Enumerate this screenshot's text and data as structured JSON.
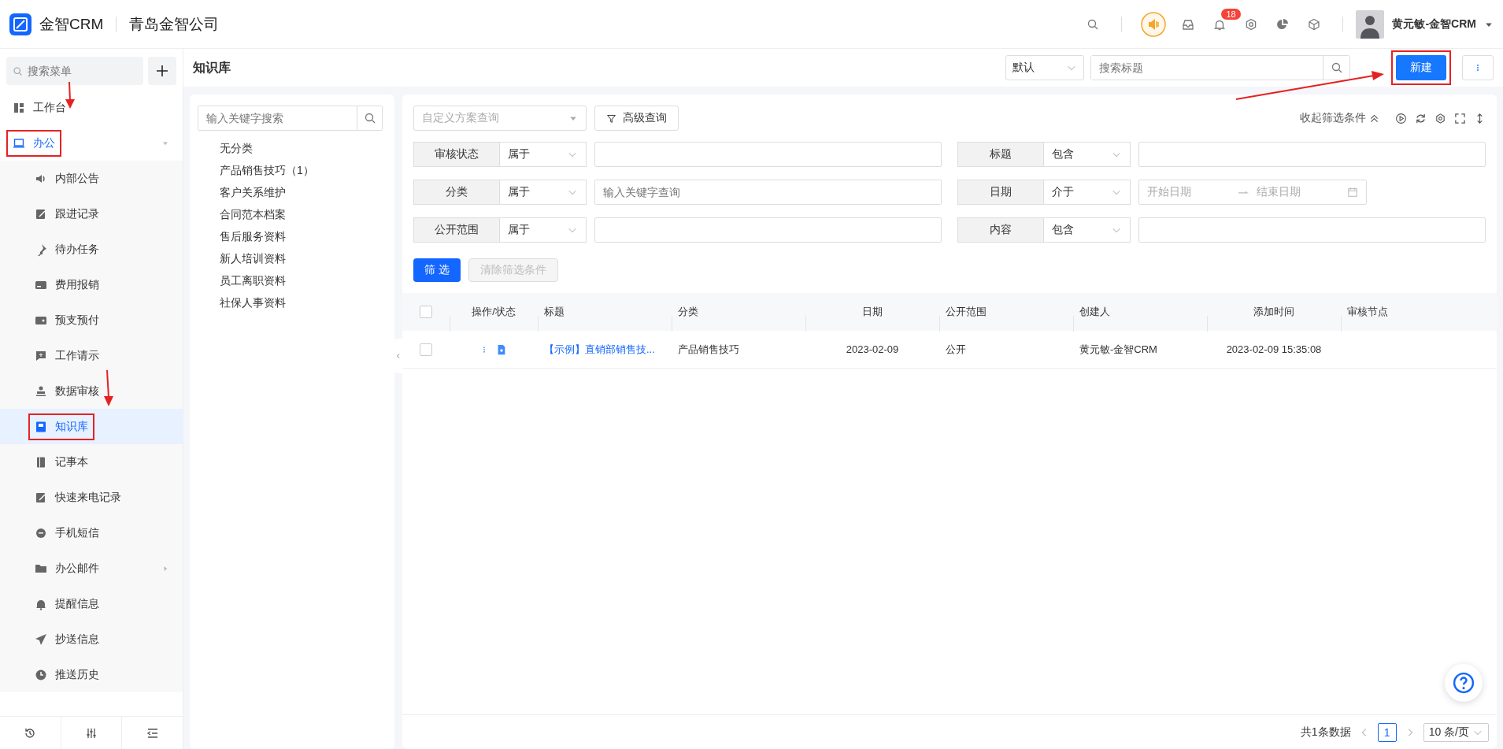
{
  "topbar": {
    "brand": "金智CRM",
    "company": "青岛金智公司",
    "notification_count": "18",
    "user": "黄元敏-金智CRM"
  },
  "sidebar": {
    "search_placeholder": "搜索菜单",
    "items": [
      {
        "label": "工作台",
        "kind": "link",
        "selected": false,
        "highlighted": false
      },
      {
        "label": "办公",
        "kind": "group",
        "expanded": true,
        "selected": false,
        "highlighted": true,
        "children": [
          {
            "label": "内部公告",
            "kind": "link",
            "selected": false,
            "highlighted": false
          },
          {
            "label": "跟进记录",
            "kind": "link",
            "selected": false,
            "highlighted": false
          },
          {
            "label": "待办任务",
            "kind": "link",
            "selected": false,
            "highlighted": false
          },
          {
            "label": "费用报销",
            "kind": "link",
            "selected": false,
            "highlighted": false
          },
          {
            "label": "预支预付",
            "kind": "link",
            "selected": false,
            "highlighted": false
          },
          {
            "label": "工作请示",
            "kind": "link",
            "selected": false,
            "highlighted": false
          },
          {
            "label": "数据审核",
            "kind": "link",
            "selected": false,
            "highlighted": false
          },
          {
            "label": "知识库",
            "kind": "link",
            "selected": true,
            "highlighted": true
          },
          {
            "label": "记事本",
            "kind": "link",
            "selected": false,
            "highlighted": false
          },
          {
            "label": "快速来电记录",
            "kind": "link",
            "selected": false,
            "highlighted": false
          },
          {
            "label": "手机短信",
            "kind": "link",
            "selected": false,
            "highlighted": false
          },
          {
            "label": "办公邮件",
            "kind": "group",
            "expanded": false,
            "selected": false,
            "highlighted": false
          },
          {
            "label": "提醒信息",
            "kind": "link",
            "selected": false,
            "highlighted": false
          },
          {
            "label": "抄送信息",
            "kind": "link",
            "selected": false,
            "highlighted": false
          },
          {
            "label": "推送历史",
            "kind": "link",
            "selected": false,
            "highlighted": false
          }
        ]
      }
    ]
  },
  "page": {
    "title": "知识库",
    "view_select": "默认",
    "search_placeholder": "搜索标题",
    "new_button": {
      "label": "新建",
      "highlighted": true
    }
  },
  "tree": {
    "search_placeholder": "输入关键字搜索",
    "items": [
      {
        "label": "无分类"
      },
      {
        "label": "产品销售技巧（1）"
      },
      {
        "label": "客户关系维护"
      },
      {
        "label": "合同范本档案"
      },
      {
        "label": "售后服务资料"
      },
      {
        "label": "新人培训资料"
      },
      {
        "label": "员工离职资料"
      },
      {
        "label": "社保人事资料"
      }
    ]
  },
  "filters": {
    "scheme_placeholder": "自定义方案查询",
    "advanced_button": "高级查询",
    "collapse_link": "收起筛选条件",
    "fields": [
      {
        "kind": "text",
        "label": "审核状态",
        "operator": "属于"
      },
      {
        "kind": "text",
        "label": "标题",
        "operator": "包含"
      },
      {
        "kind": "text",
        "label": "分类",
        "operator": "属于",
        "placeholder": "输入关键字查询"
      },
      {
        "kind": "date_range",
        "label": "日期",
        "operator": "介于",
        "start_placeholder": "开始日期",
        "end_placeholder": "结束日期"
      },
      {
        "kind": "text",
        "label": "公开范围",
        "operator": "属于"
      },
      {
        "kind": "text",
        "label": "内容",
        "operator": "包含"
      }
    ],
    "apply_button": "筛 选",
    "clear_button": {
      "label": "清除筛选条件",
      "disabled": true
    }
  },
  "table": {
    "columns": [
      "操作/状态",
      "标题",
      "分类",
      "日期",
      "公开范围",
      "创建人",
      "添加时间",
      "审核节点"
    ],
    "all_checked": false,
    "rows": [
      {
        "checked": false,
        "title": "【示例】直销部销售技...",
        "category": "产品销售技巧",
        "date": "2023-02-09",
        "scope": "公开",
        "creator": "黄元敏-金智CRM",
        "added": "2023-02-09 15:35:08"
      }
    ]
  },
  "pagination": {
    "total": "共1条数据",
    "pages": [
      {
        "label": "1",
        "selected": true
      }
    ],
    "page_size": "10 条/页"
  }
}
